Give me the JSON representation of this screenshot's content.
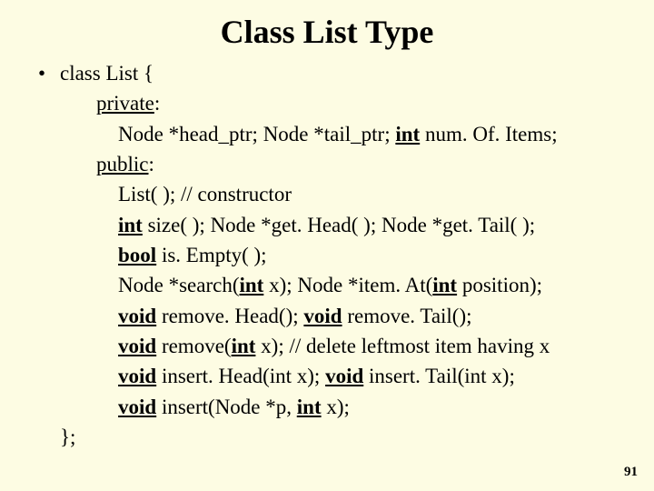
{
  "title": "Class List Type",
  "bullet": "•",
  "l0": "class List {",
  "priv": "private",
  "colon": ":",
  "node": "Node",
  "headptr": " *head_ptr; ",
  "tailptr": " *tail_ptr; ",
  "int": "int",
  "numof": " num. Of. Items;",
  "pub": "public",
  "ctor": "List( ); // constructor",
  "size": " size( );       ",
  "gethead": " *get. Head( );      ",
  "gettail": " *get. Tail( );",
  "bool": "bool",
  "isempty": " is. Empty( );",
  "search": " *search(",
  "xparen": " x);",
  "itemat_pre": " *item. At(",
  "itemat_post": " position);",
  "void": "void",
  "removehead": " remove. Head();",
  "removetail": " remove. Tail();",
  "remove_pre": " remove(",
  "remove_post": " x); // delete leftmost item having x",
  "inserthead": " insert. Head(int x);",
  "inserttail": " insert. Tail(int x);",
  "insert_pre": " insert(Node *p, ",
  "close": "};",
  "pagenum": "91",
  "sp_med": "           ",
  "sp_lg": "            ",
  "sp_sm": "        "
}
